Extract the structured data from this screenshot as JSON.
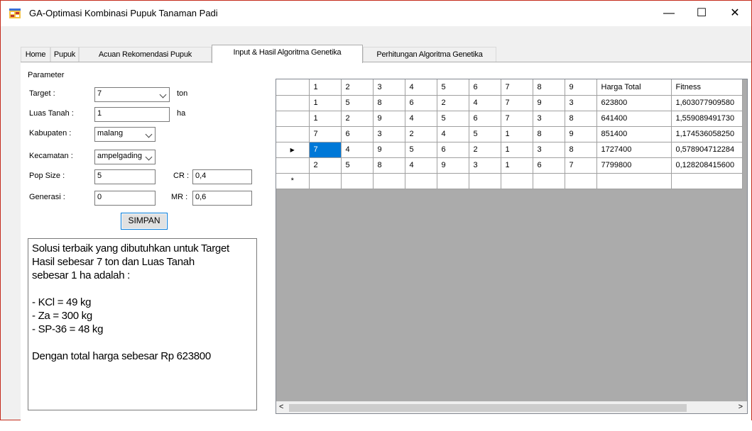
{
  "window": {
    "title": "GA-Optimasi Kombinasi Pupuk Tanaman Padi",
    "minimize": "—",
    "maximize": "☐",
    "close": "✕"
  },
  "tabs": [
    {
      "label": "Home"
    },
    {
      "label": "Pupuk"
    },
    {
      "label": "Acuan Rekomendasi Pupuk"
    },
    {
      "label": "Input & Hasil Algoritma Genetika"
    },
    {
      "label": "Perhitungan Algoritma Genetika"
    }
  ],
  "form": {
    "section_label": "Parameter",
    "target_label": "Target :",
    "target_value": "7",
    "target_unit": "ton",
    "luas_label": "Luas Tanah :",
    "luas_value": "1",
    "luas_unit": "ha",
    "kabupaten_label": "Kabupaten :",
    "kabupaten_value": "malang",
    "kecamatan_label": "Kecamatan :",
    "kecamatan_value": "ampelgading",
    "popsize_label": "Pop Size :",
    "popsize_value": "5",
    "cr_label": "CR :",
    "cr_value": "0,4",
    "generasi_label": "Generasi :",
    "generasi_value": "0",
    "mr_label": "MR :",
    "mr_value": "0,6",
    "simpan_label": "SIMPAN"
  },
  "result": {
    "lines": [
      "Solusi terbaik yang dibutuhkan untuk Target",
      "Hasil sebesar 7 ton dan Luas Tanah",
      "sebesar 1 ha adalah :",
      "",
      "- KCl = 49 kg",
      "- Za = 300 kg",
      "- SP-36 = 48 kg",
      "",
      "Dengan total harga sebesar Rp 623800"
    ]
  },
  "grid": {
    "columns": [
      "1",
      "2",
      "3",
      "4",
      "5",
      "6",
      "7",
      "8",
      "9",
      "Harga Total",
      "Fitness"
    ],
    "rows": [
      [
        "1",
        "5",
        "8",
        "6",
        "2",
        "4",
        "7",
        "9",
        "3",
        "623800",
        "1,603077909580"
      ],
      [
        "1",
        "2",
        "9",
        "4",
        "5",
        "6",
        "7",
        "3",
        "8",
        "641400",
        "1,559089491730"
      ],
      [
        "7",
        "6",
        "3",
        "2",
        "4",
        "5",
        "1",
        "8",
        "9",
        "851400",
        "1,174536058250"
      ],
      [
        "7",
        "4",
        "9",
        "5",
        "6",
        "2",
        "1",
        "3",
        "8",
        "1727400",
        "0,578904712284"
      ],
      [
        "2",
        "5",
        "8",
        "4",
        "9",
        "3",
        "1",
        "6",
        "7",
        "7799800",
        "0,128208415600"
      ]
    ],
    "current_row_marker": "▶",
    "new_row_marker": "*",
    "scroll_left": "<",
    "scroll_right": ">"
  },
  "colors": {
    "accent": "#0078d7",
    "close_border": "#c42b1c",
    "grid_empty": "#ababab"
  }
}
